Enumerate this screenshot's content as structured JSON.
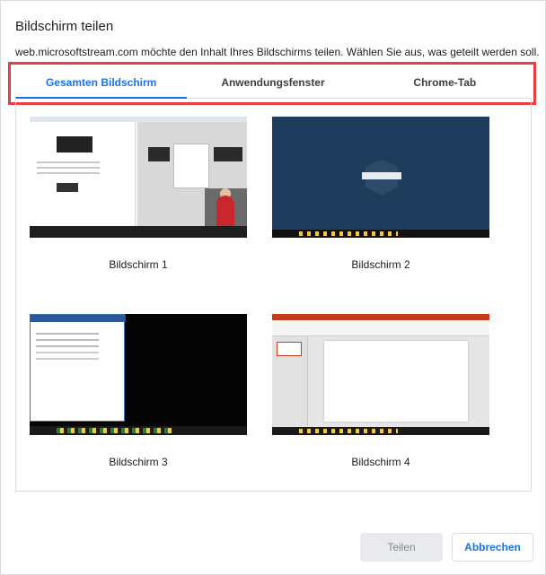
{
  "dialog": {
    "title": "Bildschirm teilen",
    "subtitle": "web.microsoftstream.com möchte den Inhalt Ihres Bildschirms teilen. Wählen Sie aus, was geteilt werden soll."
  },
  "tabs": [
    {
      "label": "Gesamten Bildschirm",
      "active": true
    },
    {
      "label": "Anwendungsfenster",
      "active": false
    },
    {
      "label": "Chrome-Tab",
      "active": false
    }
  ],
  "screens": [
    {
      "label": "Bildschirm 1"
    },
    {
      "label": "Bildschirm 2"
    },
    {
      "label": "Bildschirm 3"
    },
    {
      "label": "Bildschirm 4"
    }
  ],
  "buttons": {
    "share": "Teilen",
    "cancel": "Abbrechen"
  },
  "colors": {
    "accent": "#1a73e8",
    "highlight": "#e53e45",
    "disabled_bg": "#e8eaed"
  }
}
